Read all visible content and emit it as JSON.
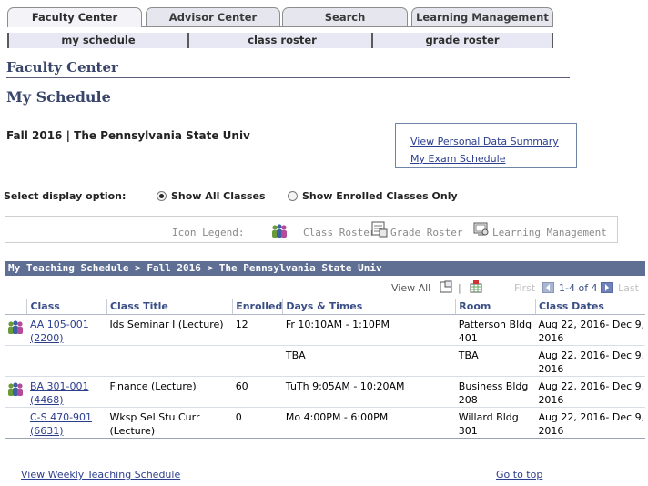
{
  "tabs": [
    {
      "label": "Faculty Center",
      "active": true
    },
    {
      "label": "Advisor Center",
      "active": false
    },
    {
      "label": "Search",
      "active": false
    },
    {
      "label": "Learning Management",
      "active": false
    }
  ],
  "subtabs": [
    {
      "label": "my schedule",
      "active": true
    },
    {
      "label": "class roster",
      "active": false
    },
    {
      "label": "grade roster",
      "active": false
    }
  ],
  "center_title": "Faculty Center",
  "page_title": "My Schedule",
  "term": "Fall 2016 | The Pennsylvania State Univ",
  "links": {
    "personal_data": "View Personal Data Summary",
    "exam_schedule": "My Exam Schedule"
  },
  "display_option": {
    "label": "Select display option:",
    "show_all": "Show All Classes",
    "show_enrolled": "Show Enrolled Classes Only",
    "selected": "show_all"
  },
  "legend": {
    "label": "Icon Legend:",
    "class_roster": "Class Roster",
    "grade_roster": "Grade Roster",
    "learning_mgmt": "Learning Management"
  },
  "grid": {
    "title": "My Teaching Schedule > Fall 2016 > The Pennsylvania State Univ",
    "view_all": "View All",
    "first": "First",
    "range": "1-4 of 4",
    "last": "Last",
    "columns": [
      "Class",
      "Class Title",
      "Enrolled",
      "Days & Times",
      "Room",
      "Class Dates"
    ],
    "rows": [
      {
        "icon": true,
        "class_line1": "AA 105-001",
        "class_line2": "(2200)",
        "title": "Ids Seminar I (Lecture)",
        "enrolled": "12",
        "days_times": "Fr 10:10AM - 1:10PM",
        "room": "Patterson Bldg 401",
        "dates": "Aug 22, 2016- Dec 9, 2016"
      },
      {
        "icon": false,
        "class_line1": "",
        "class_line2": "",
        "title": "",
        "enrolled": "",
        "days_times": "TBA",
        "room": "TBA",
        "dates": "Aug 22, 2016- Dec 9, 2016"
      },
      {
        "icon": true,
        "class_line1": "BA 301-001",
        "class_line2": "(4468)",
        "title": "Finance (Lecture)",
        "enrolled": "60",
        "days_times": "TuTh 9:05AM - 10:20AM",
        "room": "Business Bldg 208",
        "dates": "Aug 22, 2016- Dec 9, 2016"
      },
      {
        "icon": false,
        "class_line1": "C-S 470-901",
        "class_line2": "(6631)",
        "title": "Wksp Sel Stu Curr (Lecture)",
        "enrolled": "0",
        "days_times": "Mo 4:00PM - 6:00PM",
        "room": "Willard Bldg 301",
        "dates": "Aug 22, 2016- Dec 9, 2016"
      }
    ]
  },
  "footer": {
    "weekly": "View Weekly Teaching Schedule",
    "top": "Go to top"
  },
  "icons": {
    "class_roster": "people-icon",
    "grade_roster": "grade-roster-icon",
    "learning_mgmt": "learning-management-icon",
    "zoom": "zoom-icon",
    "download": "download-icon",
    "prev": "prev-arrow-icon",
    "next": "next-arrow-icon"
  }
}
